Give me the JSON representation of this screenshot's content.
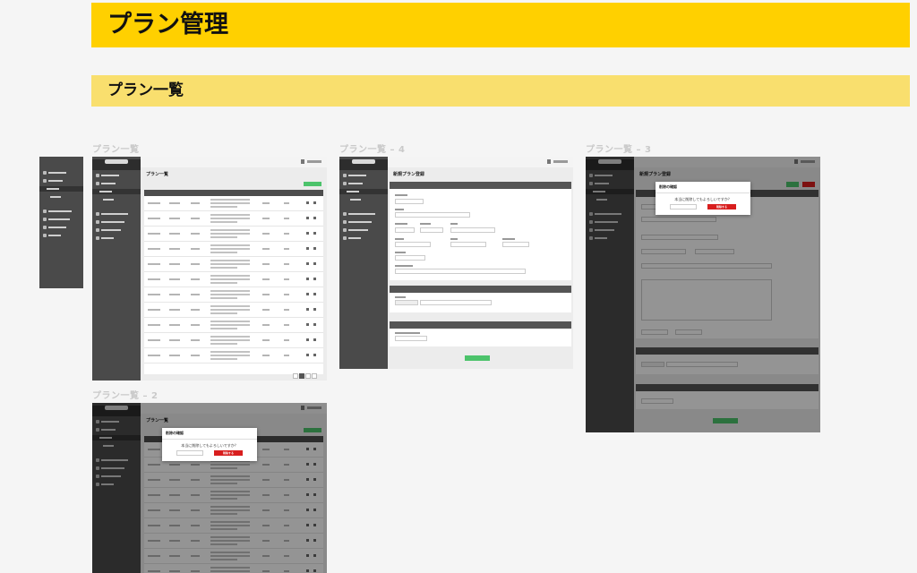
{
  "page": {
    "title": "プラン管理",
    "section": "プラン一覧"
  },
  "frames": {
    "list": "プラン一覧",
    "new": "プラン一覧 – 4",
    "confirm_edit": "プラン一覧 – 3",
    "confirm_list": "プラン一覧 – 2"
  },
  "mock": {
    "list_heading": "プラン一覧",
    "new_heading": "新規プラン登録",
    "modal_title": "削除の確認",
    "modal_message": "本当に削除してもよろしいですか？",
    "modal_delete": "削除する"
  },
  "colors": {
    "accent": "#ffd000",
    "section": "#f9df6e",
    "sidebar": "#4a4a4a",
    "primary": "#4cc36b",
    "danger": "#d81e1e"
  }
}
